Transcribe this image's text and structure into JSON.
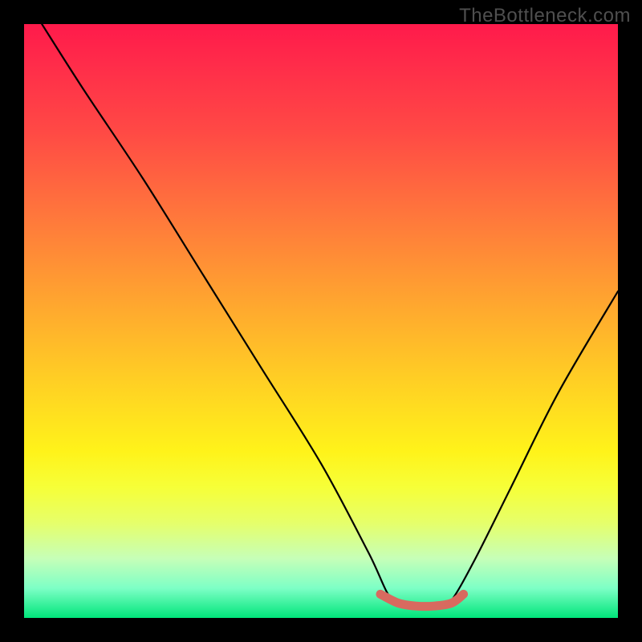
{
  "watermark": "TheBottleneck.com",
  "chart_data": {
    "type": "line",
    "title": "",
    "xlabel": "",
    "ylabel": "",
    "xlim": [
      0,
      100
    ],
    "ylim": [
      0,
      100
    ],
    "notes": "V-shaped bottleneck curve on a red-to-green vertical gradient. Minimum (flat segment, highlighted in salmon) around x≈62–72 at y≈2. Left branch starts near (3,100); right branch ends near (100,55).",
    "series": [
      {
        "name": "bottleneck-curve",
        "x": [
          3,
          10,
          20,
          30,
          40,
          50,
          58,
          62,
          66,
          70,
          72,
          76,
          82,
          90,
          100
        ],
        "y": [
          100,
          89,
          74,
          58,
          42,
          26,
          11,
          3,
          2,
          2,
          3,
          10,
          22,
          38,
          55
        ]
      }
    ],
    "highlight": {
      "name": "min-flat-segment",
      "x": [
        60,
        63,
        66,
        69,
        72,
        74
      ],
      "y": [
        4,
        2.5,
        2,
        2,
        2.5,
        4
      ],
      "color": "#d86a5f"
    },
    "gradient_stops": [
      {
        "pos": 0,
        "color": "#ff1a4b"
      },
      {
        "pos": 50,
        "color": "#ffbf28"
      },
      {
        "pos": 80,
        "color": "#f3ff40"
      },
      {
        "pos": 100,
        "color": "#00e57a"
      }
    ]
  }
}
